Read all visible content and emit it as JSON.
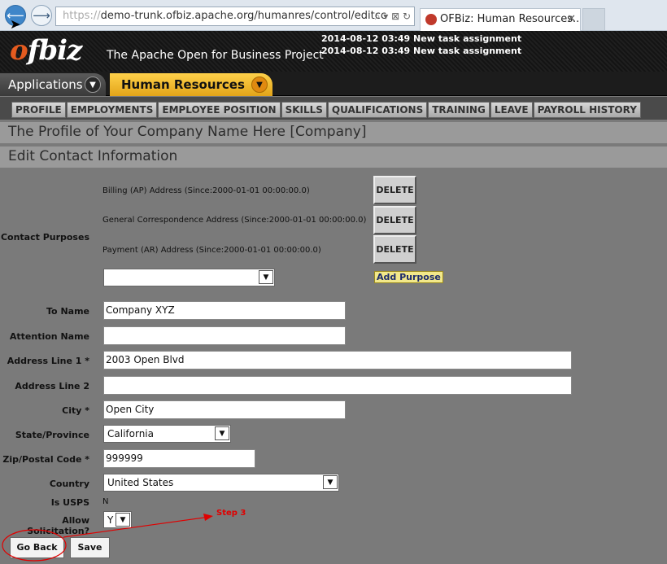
{
  "browser": {
    "url_host": "demo-trunk.ofbiz.apache.org",
    "url_prefix": "https://",
    "url_path": "/humanres/control/editcc",
    "url_ghost": "OFBiz: Human Res",
    "tab_title": "OFBiz: Human Resources...",
    "tab_close": "✕",
    "back_glyph": "⟵",
    "forward_glyph": "⟶",
    "addr_icons": "⌕ ▾ ⊠ ↻"
  },
  "header": {
    "logo": "ofbiz",
    "tagline": "The Apache Open for Business Project",
    "notices": [
      "2014-08-12 03:49 New task assignment",
      "2014-08-12 03:49 New task assignment"
    ]
  },
  "appbar": {
    "applications": "Applications",
    "current_app": "Human Resources"
  },
  "submenu": [
    "PROFILE",
    "EMPLOYMENTS",
    "EMPLOYEE POSITION",
    "SKILLS",
    "QUALIFICATIONS",
    "TRAINING",
    "LEAVE",
    "PAYROLL HISTORY"
  ],
  "page_title": "The Profile of Your Company Name Here [Company]",
  "section_title": "Edit Contact Information",
  "form": {
    "contact_purposes_label": "Contact Purposes",
    "purposes": [
      "Billing (AP) Address (Since:2000-01-01 00:00:00.0)",
      "General Correspondence Address (Since:2000-01-01 00:00:00.0)",
      "Payment (AR) Address (Since:2000-01-01 00:00:00.0)"
    ],
    "delete_label": "DELETE",
    "purpose_select_value": "",
    "add_purpose_label": "Add Purpose",
    "to_name_label": "To Name",
    "to_name_value": "Company XYZ",
    "attention_label": "Attention Name",
    "attention_value": "",
    "address1_label": "Address Line 1 *",
    "address1_value": "2003 Open Blvd",
    "address2_label": "Address Line 2",
    "address2_value": "",
    "city_label": "City *",
    "city_value": "Open City",
    "state_label": "State/Province",
    "state_value": "California",
    "zip_label": "Zip/Postal Code *",
    "zip_value": "999999",
    "country_label": "Country",
    "country_value": "United States",
    "usps_label": "Is USPS",
    "usps_value": "N",
    "solicitation_label": "Allow Solicitation?",
    "solicitation_value": "Y",
    "go_back_label": "Go Back",
    "save_label": "Save"
  },
  "annotation": {
    "step_label": "Step 3",
    "color": "#e00000"
  },
  "colors": {
    "page_bg": "#7a7a7a",
    "accent": "#f0b429",
    "header_bg": "#1a1a1a"
  }
}
